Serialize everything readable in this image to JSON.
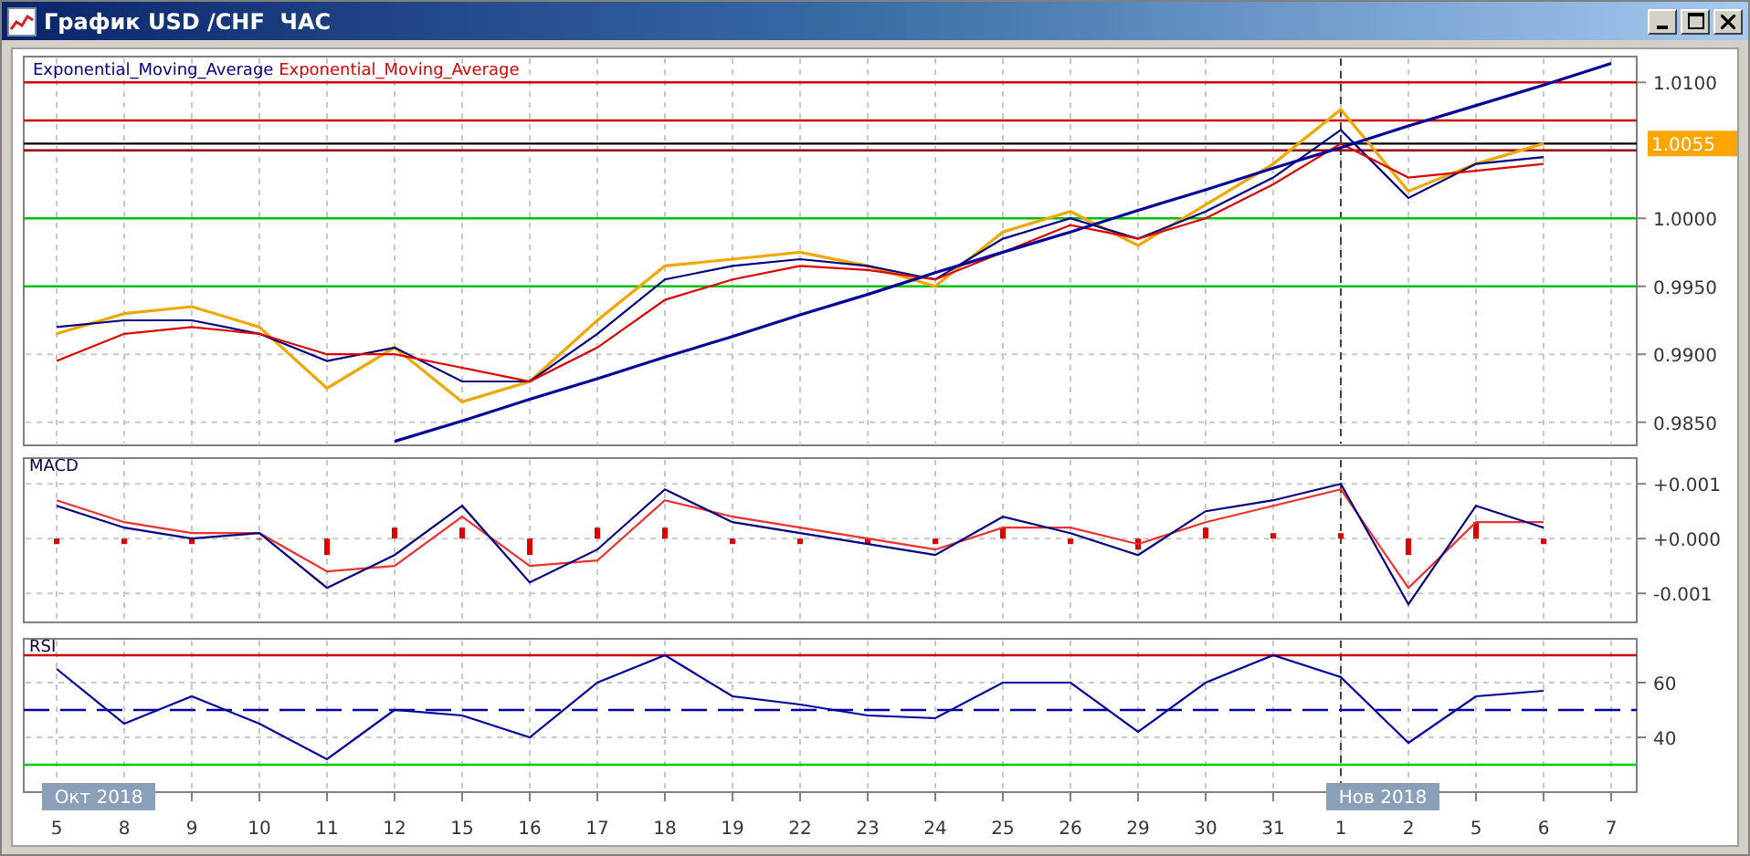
{
  "window": {
    "title": "График USD /CHF  ЧАС"
  },
  "panes": [
    {
      "chart_data": {
        "type": "line",
        "grid": true,
        "ylim": [
          0.9833,
          1.0119
        ],
        "yticks": [
          {
            "value": 0.985,
            "label": "0.9850"
          },
          {
            "value": 0.99,
            "label": "0.9900"
          },
          {
            "value": 0.995,
            "label": "0.9950"
          },
          {
            "value": 1.0,
            "label": "1.0000"
          },
          {
            "value": 1.01,
            "label": "1.0100"
          }
        ],
        "series": [
          {
            "color": "#f0a800",
            "values": [
              0.9915,
              0.993,
              0.9935,
              0.992,
              0.9875,
              0.9905,
              0.9865,
              0.988,
              0.9925,
              0.9965,
              0.997,
              0.9975,
              0.9965,
              0.995,
              0.999,
              1.0005,
              0.998,
              1.001,
              1.004,
              1.008,
              1.002,
              1.004,
              1.0055,
              null
            ]
          },
          {
            "name": "Exponential_Moving_Average",
            "color": "#000080",
            "values": [
              0.992,
              0.9925,
              0.9925,
              0.9915,
              0.9895,
              0.9905,
              0.988,
              0.988,
              0.9915,
              0.9955,
              0.9965,
              0.997,
              0.9965,
              0.9955,
              0.9985,
              1.0,
              0.9985,
              1.0005,
              1.003,
              1.0065,
              1.0015,
              1.004,
              1.0045,
              null
            ]
          },
          {
            "name": "Exponential_Moving_Average",
            "color": "#dd0000",
            "values": [
              0.9895,
              0.9915,
              0.992,
              0.9915,
              0.99,
              0.99,
              0.989,
              0.988,
              0.9905,
              0.994,
              0.9955,
              0.9965,
              0.9962,
              0.9955,
              0.9975,
              0.9995,
              0.9985,
              1.0,
              1.0025,
              1.0055,
              1.003,
              1.0035,
              1.004,
              null
            ]
          },
          {
            "color": "#000099",
            "values": [
              null,
              null,
              null,
              null,
              null,
              0.9836,
              0.9851,
              0.9867,
              0.9882,
              0.9898,
              0.9913,
              0.9929,
              0.9944,
              0.996,
              0.9975,
              0.999,
              1.0006,
              1.0021,
              1.0037,
              1.0052,
              1.0068,
              1.0083,
              1.0098,
              1.0114
            ]
          }
        ],
        "ref_lines": [
          {
            "axis": "y",
            "value": 1.01,
            "color": "#cc0000"
          },
          {
            "axis": "y",
            "value": 1.0072,
            "color": "#cc0000"
          },
          {
            "axis": "y",
            "value": 1.0055,
            "color": "#000000"
          },
          {
            "axis": "y",
            "value": 1.005,
            "color": "#990000"
          },
          {
            "axis": "y",
            "value": 1.0,
            "color": "#00c000"
          },
          {
            "axis": "y",
            "value": 0.995,
            "color": "#00c000"
          }
        ],
        "annotations": [
          "1.0055"
        ]
      }
    },
    {
      "chart_data": {
        "type": "line",
        "title": "MACD",
        "grid": true,
        "ylim": [
          -0.00153,
          0.00147
        ],
        "yticks": [
          {
            "value": 0.001,
            "label": "+0.001"
          },
          {
            "value": 0,
            "label": "+0.000"
          },
          {
            "value": -0.001,
            "label": "-0.001"
          }
        ],
        "series": [
          {
            "type": "bar",
            "color": "#dd0000",
            "values": [
              -0.0001,
              -0.0001,
              -0.0001,
              0,
              -0.0003,
              0.0002,
              0.0002,
              -0.0003,
              0.0002,
              0.0002,
              -0.0001,
              -0.0001,
              -0.0001,
              -0.0001,
              0.0002,
              -0.0001,
              -0.0002,
              0.0002,
              0.0001,
              0.0001,
              -0.0003,
              0.0003,
              -0.0001,
              null
            ]
          },
          {
            "color": "#ee3030",
            "values": [
              0.0007,
              0.0003,
              0.0001,
              0.0001,
              -0.0006,
              -0.0005,
              0.0004,
              -0.0005,
              -0.0004,
              0.0007,
              0.0004,
              0.0002,
              0.0,
              -0.0002,
              0.0002,
              0.0002,
              -0.0001,
              0.0003,
              0.0006,
              0.0009,
              -0.0009,
              0.0003,
              0.0003,
              null
            ]
          },
          {
            "color": "#000080",
            "values": [
              0.0006,
              0.0002,
              0.0,
              0.0001,
              -0.0009,
              -0.0003,
              0.0006,
              -0.0008,
              -0.0002,
              0.0009,
              0.0003,
              0.0001,
              -0.0001,
              -0.0003,
              0.0004,
              0.0001,
              -0.0003,
              0.0005,
              0.0007,
              0.001,
              -0.0012,
              0.0006,
              0.0002,
              null
            ]
          }
        ]
      }
    },
    {
      "chart_data": {
        "type": "line",
        "title": "RSI",
        "grid": true,
        "categories": [
          "5",
          "8",
          "9",
          "10",
          "11",
          "12",
          "15",
          "16",
          "17",
          "18",
          "19",
          "22",
          "23",
          "24",
          "25",
          "26",
          "29",
          "30",
          "31",
          "1",
          "2",
          "5",
          "6",
          "7"
        ],
        "ylim": [
          20,
          76
        ],
        "yticks": [
          {
            "value": 60,
            "label": "60"
          },
          {
            "value": 40,
            "label": "40"
          }
        ],
        "series": [
          {
            "color": "#0000a0",
            "values": [
              65,
              45,
              55,
              45,
              32,
              50,
              48,
              40,
              60,
              70,
              55,
              52,
              48,
              47,
              60,
              60,
              42,
              60,
              70,
              62,
              38,
              55,
              57,
              null
            ]
          }
        ],
        "ref_lines": [
          {
            "axis": "y",
            "value": 70,
            "color": "#cc0000"
          },
          {
            "axis": "y",
            "value": 50,
            "color": "#0000a0"
          },
          {
            "axis": "y",
            "value": 30,
            "color": "#00cc00"
          },
          {
            "axis": "x",
            "value": "1",
            "color": "#404040"
          }
        ],
        "annotations": [
          "Окт 2018",
          "Нов 2018"
        ]
      }
    }
  ]
}
